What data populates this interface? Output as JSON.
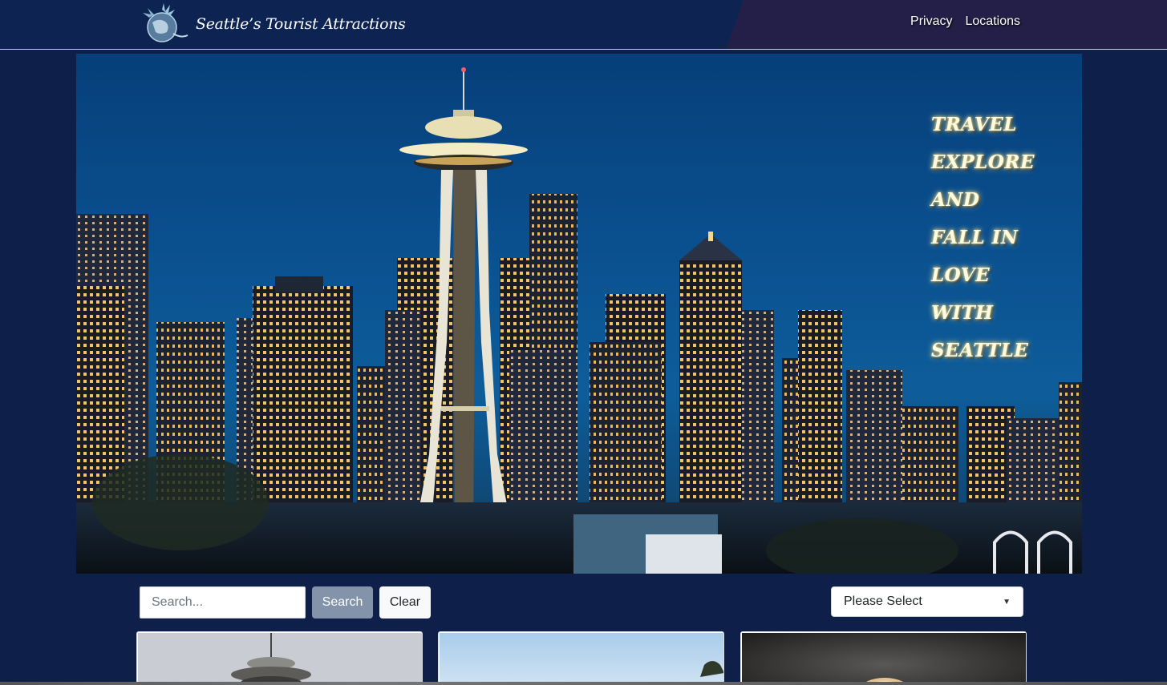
{
  "navbar": {
    "brand": "Seattle’s Tourist Attractions",
    "links": [
      "Privacy",
      "Locations"
    ]
  },
  "hero": {
    "tagline": [
      "TRAVEL",
      "EXPLORE",
      "AND",
      "FALL IN",
      "LOVE",
      "WITH",
      "SEATTLE"
    ]
  },
  "search": {
    "placeholder": "Search...",
    "search_label": "Search",
    "clear_label": "Clear"
  },
  "filter": {
    "selected": "Please Select"
  },
  "colors": {
    "page_bg": "#0e1f4a",
    "navbar_bg": "#0d2453",
    "navbar_accent": "#231f48",
    "search_button": "#8393aa"
  }
}
